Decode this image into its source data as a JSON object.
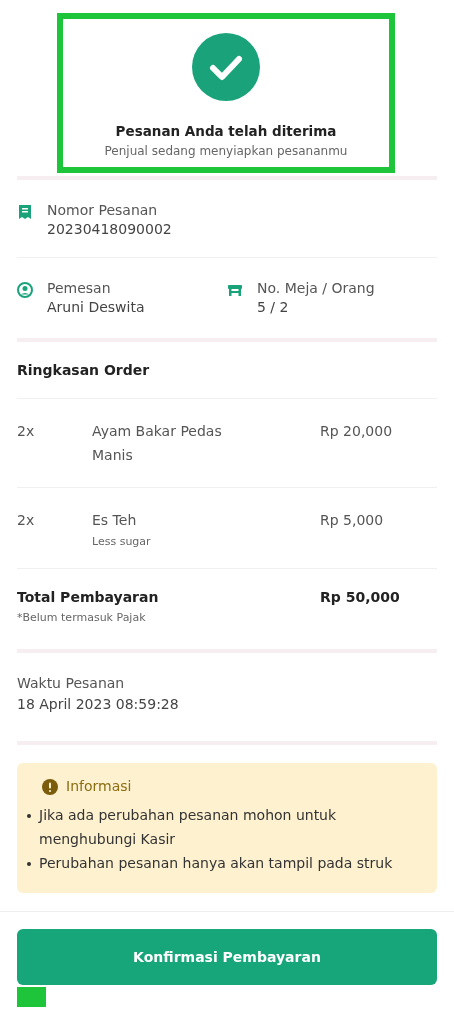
{
  "header": {
    "title": "Pesanan Anda telah diterima",
    "subtitle": "Penjual sedang menyiapkan pesananmu",
    "highlighted": true
  },
  "order_number": {
    "label": "Nomor Pesanan",
    "value": "20230418090002"
  },
  "customer": {
    "label": "Pemesan",
    "value": "Aruni Deswita"
  },
  "table": {
    "label": "No. Meja / Orang",
    "value": "5 / 2"
  },
  "summary": {
    "title": "Ringkasan Order",
    "items": [
      {
        "qty": "2x",
        "name": "Ayam Bakar Pedas Manis",
        "price": "Rp 20,000"
      },
      {
        "qty": "2x",
        "name": "Es Teh",
        "note": "Less sugar",
        "price": "Rp 5,000"
      }
    ],
    "total_label": "Total Pembayaran",
    "total": "Rp 50,000",
    "tax_note": "*Belum termasuk Pajak"
  },
  "order_time": {
    "label": "Waktu Pesanan",
    "value": "18 April 2023 08:59:28"
  },
  "info": {
    "title": "Informasi",
    "points": [
      "Jika ada perubahan pesanan mohon untuk menghubungi Kasir",
      "Perubahan pesanan hanya akan tampil pada struk"
    ]
  },
  "button": {
    "label": "Konfirmasi Pembayaran"
  }
}
